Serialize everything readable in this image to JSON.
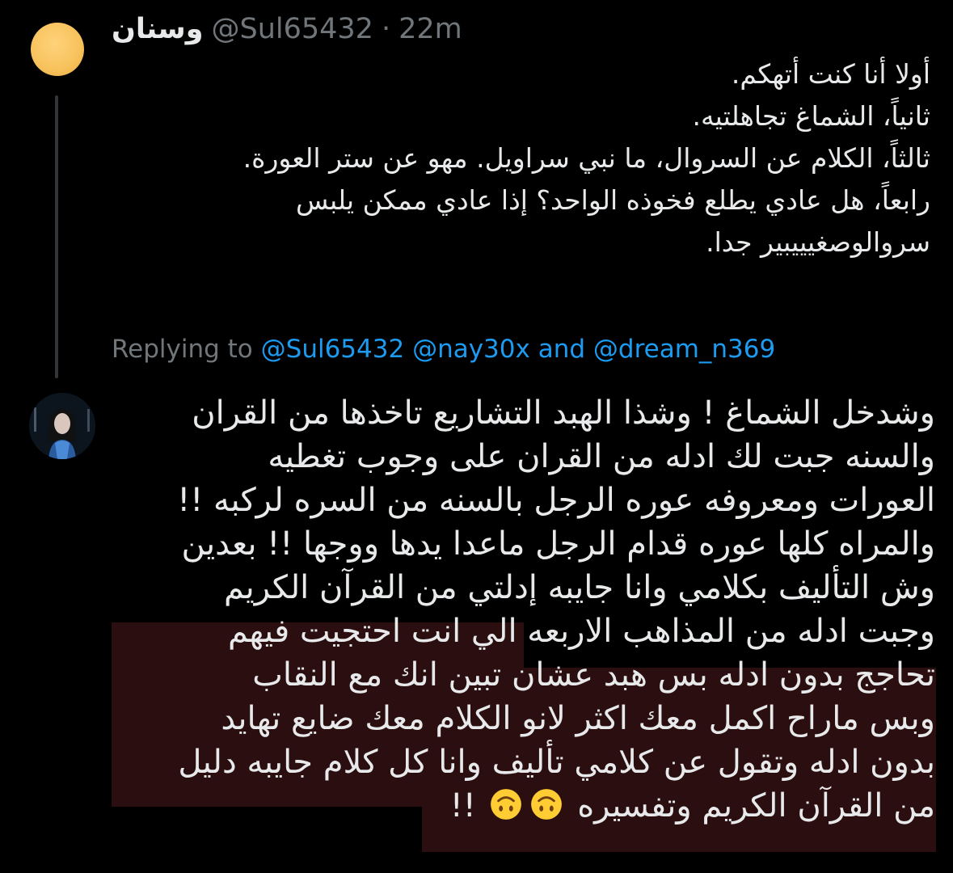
{
  "parent_tweet": {
    "display_name": "وسنان",
    "handle": "@Sul65432",
    "separator": "·",
    "time": "22m",
    "lines": [
      "أولا أنا كنت أتهكم.",
      "ثانياً، الشماغ تجاهلتيه.",
      "ثالثاً، الكلام عن السروال، ما نبي سراويل. مهو عن ستر العورة.",
      "رابعاً، هل عادي يطلع فخوذه الواحد؟ إذا عادي ممكن يلبس",
      "سروالوصغيييبير جدا."
    ]
  },
  "replying": {
    "prefix": "Replying to",
    "mention1": "@Sul65432",
    "mention2": "@nay30x",
    "conjunction": "and",
    "mention3": "@dream_n369"
  },
  "reply_tweet": {
    "lines": [
      "وشدخل الشماغ ! وشذا الهبد التشاريع تاخذها من القران",
      "والسنه جبت لك ادله من القران على وجوب تغطيه",
      "العورات ومعروفه عوره الرجل بالسنه من السره لركبه !!",
      "والمراه كلها عوره قدام الرجل ماعدا يدها ووجها !! بعدين",
      "وش التأليف بكلامي وانا جايبه إدلتي من القرآن الكريم",
      "وجبت ادله من المذاهب الاربعه الي انت احتجيت فيهم",
      "تحاجج بدون ادله بس هبد عشان تبين انك مع النقاب",
      "وبس ماراح اكمل معك اكثر لانو الكلام معك ضايع تهايد",
      "بدون ادله وتقول عن كلامي تأليف وانا كل كلام جايبه دليل"
    ],
    "last_line_text": "من القرآن الكريم وتفسيره",
    "last_line_suffix": "!!",
    "emoji": "upside-down-face-icon",
    "highlight_color": "#2b0f10"
  }
}
